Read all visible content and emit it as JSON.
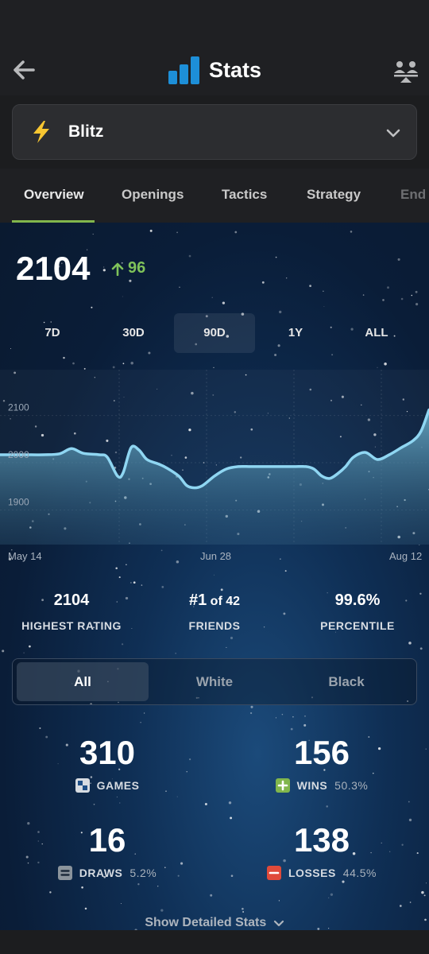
{
  "header": {
    "title": "Stats",
    "back_icon": "arrow-left-icon",
    "compare_icon": "compare-players-icon"
  },
  "game_type": {
    "label": "Blitz",
    "icon": "lightning-bolt-icon",
    "icon_color": "#f7c631"
  },
  "tabs": [
    {
      "label": "Overview",
      "active": true
    },
    {
      "label": "Openings"
    },
    {
      "label": "Tactics"
    },
    {
      "label": "Strategy"
    },
    {
      "label": "End"
    }
  ],
  "rating": {
    "value": "2104",
    "change": "96",
    "change_color": "#7fc25a"
  },
  "time_ranges": [
    {
      "label": "7D"
    },
    {
      "label": "30D"
    },
    {
      "label": "90D",
      "active": true
    },
    {
      "label": "1Y"
    },
    {
      "label": "ALL"
    }
  ],
  "chart_data": {
    "type": "area",
    "y_ticks": [
      "2100",
      "2000",
      "1900"
    ],
    "x_ticks": [
      "May 14",
      "Jun 28",
      "Aug 12"
    ],
    "ylim": [
      1810,
      2180
    ],
    "x": [
      0,
      30,
      55,
      75,
      90,
      105,
      125,
      135,
      148,
      155,
      165,
      175,
      185,
      200,
      210,
      225,
      235,
      245,
      255,
      270,
      285,
      300,
      315,
      330,
      350,
      370,
      385,
      395,
      405,
      415,
      425,
      435,
      445,
      460,
      475,
      490,
      505,
      520,
      530,
      540
    ],
    "values": [
      2000,
      2000,
      2000,
      2002,
      2013,
      2003,
      2000,
      1995,
      1955,
      1962,
      2015,
      2010,
      1990,
      1980,
      1972,
      1955,
      1935,
      1930,
      1935,
      1955,
      1970,
      1975,
      1975,
      1975,
      1975,
      1975,
      1975,
      1970,
      1955,
      1950,
      1960,
      1975,
      1995,
      2005,
      1990,
      2000,
      2015,
      2030,
      2050,
      2095
    ],
    "line_color": "#8fd6f2",
    "grid": true
  },
  "summary": [
    {
      "value": "2104",
      "label": "HIGHEST RATING"
    },
    {
      "value_main": "#1",
      "value_suffix": " of 42",
      "label": "FRIENDS"
    },
    {
      "value": "99.6%",
      "label": "PERCENTILE"
    }
  ],
  "color_filter": [
    {
      "label": "All",
      "active": true
    },
    {
      "label": "White"
    },
    {
      "label": "Black"
    }
  ],
  "stats": {
    "games": {
      "value": "310",
      "label": "GAMES",
      "icon": "chessboard-icon"
    },
    "wins": {
      "value": "156",
      "label": "WINS",
      "pct": "50.3%",
      "icon": "plus-square-icon",
      "color": "#81b64c"
    },
    "draws": {
      "value": "16",
      "label": "DRAWS",
      "pct": "5.2%",
      "icon": "equals-square-icon",
      "color": "#8b949c"
    },
    "losses": {
      "value": "138",
      "label": "LOSSES",
      "pct": "44.5%",
      "icon": "minus-square-icon",
      "color": "#e04a3a"
    }
  },
  "footer": {
    "detailed_label": "Show Detailed Stats"
  }
}
